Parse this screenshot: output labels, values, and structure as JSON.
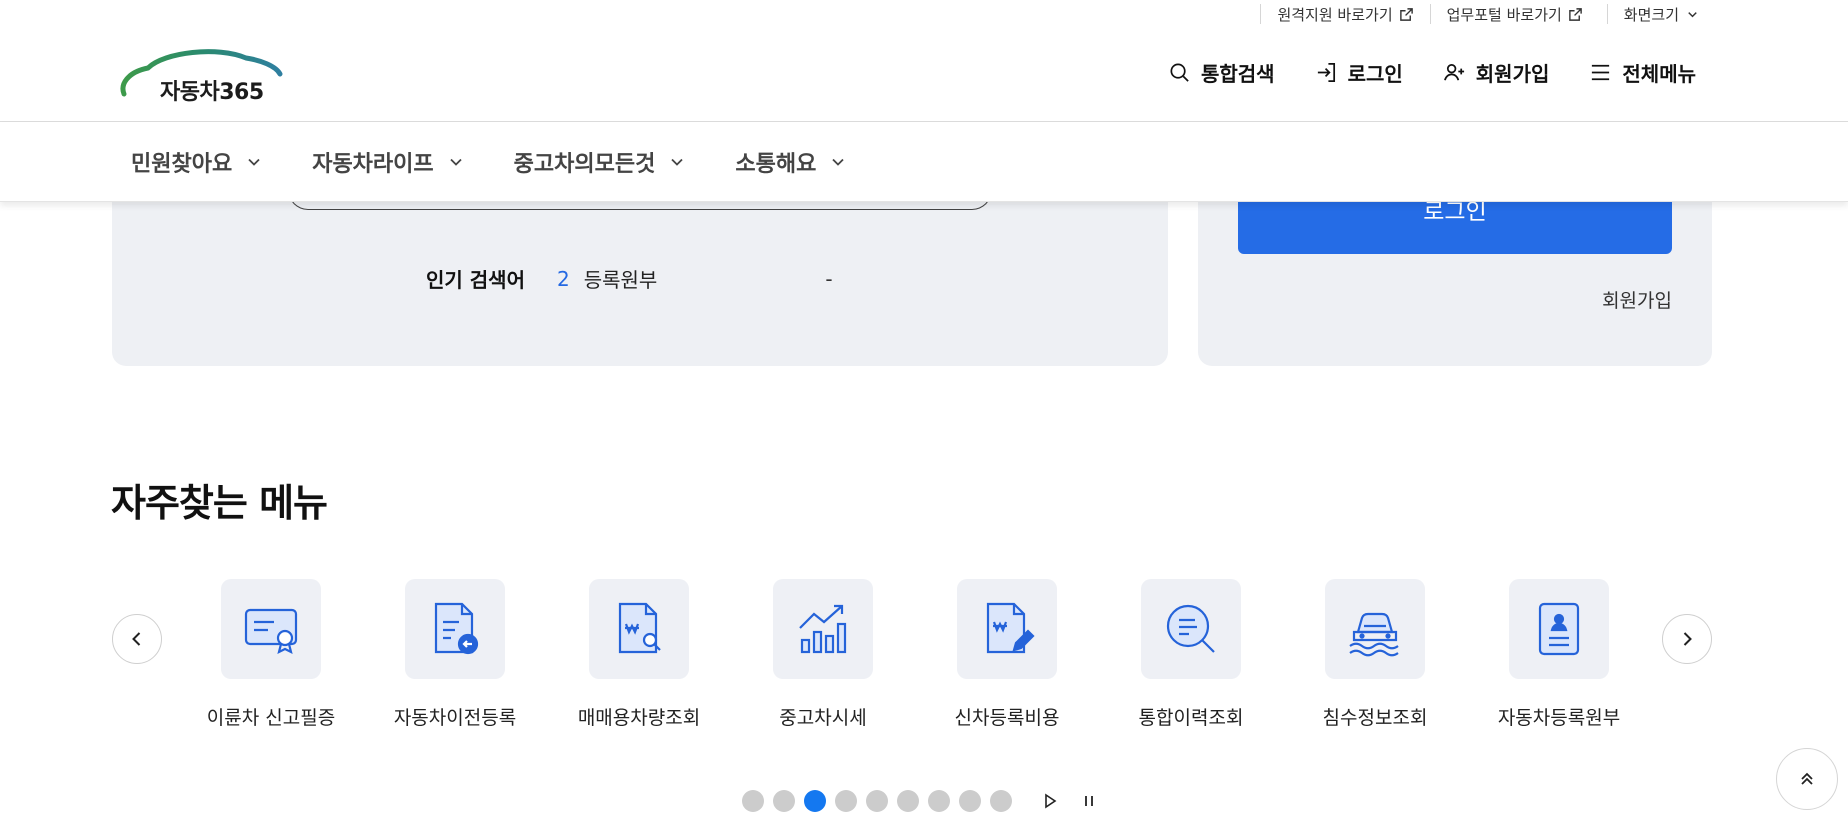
{
  "utility": {
    "remote_support": "원격지원 바로가기",
    "work_portal": "업무포털 바로가기",
    "screen_size": "화면크기"
  },
  "logo": {
    "text": "자동차365"
  },
  "header_actions": {
    "search": "통합검색",
    "login": "로그인",
    "signup": "회원가입",
    "all_menu": "전체메뉴"
  },
  "nav": {
    "items": [
      {
        "label": "민원찾아요"
      },
      {
        "label": "자동차라이프"
      },
      {
        "label": "중고차의모든것"
      },
      {
        "label": "소통해요"
      }
    ]
  },
  "search": {
    "popular_label": "인기 검색어",
    "rank": "2",
    "keyword": "등록원부",
    "dash": "-"
  },
  "login_panel": {
    "login_button": "로그인",
    "signup_link": "회원가입"
  },
  "frequent": {
    "title": "자주찾는 메뉴",
    "items": [
      {
        "label": "이륜차 신고필증",
        "icon": "certificate-icon"
      },
      {
        "label": "자동차이전등록",
        "icon": "document-transfer-icon"
      },
      {
        "label": "매매용차량조회",
        "icon": "document-search-icon"
      },
      {
        "label": "중고차시세",
        "icon": "chart-up-icon"
      },
      {
        "label": "신차등록비용",
        "icon": "document-edit-icon"
      },
      {
        "label": "통합이력조회",
        "icon": "search-list-icon"
      },
      {
        "label": "침수정보조회",
        "icon": "flood-car-icon"
      },
      {
        "label": "자동차등록원부",
        "icon": "id-card-icon"
      }
    ]
  },
  "pagination": {
    "total": 9,
    "active": 3
  },
  "colors": {
    "primary": "#256ce6",
    "panel_bg": "#eef0f4",
    "active_dot": "#1478f0",
    "logo_green": "#2a8a6e"
  }
}
